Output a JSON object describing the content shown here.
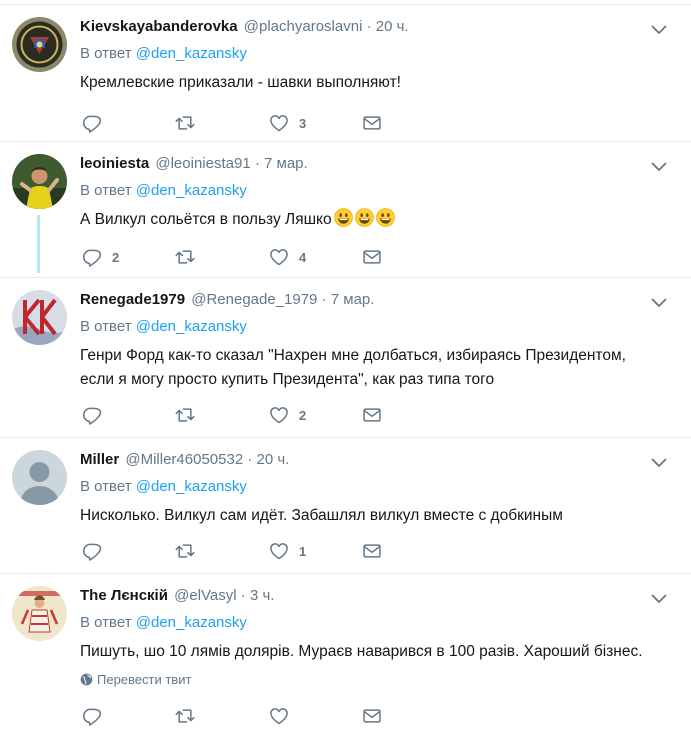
{
  "colors": {
    "accent": "#1da1f2",
    "muted": "#657786",
    "text": "#14171a",
    "border": "#e6ecf0"
  },
  "icons": {
    "reply": "reply-icon",
    "retweet": "retweet-icon",
    "like": "heart-icon",
    "message": "envelope-icon",
    "caret": "chevron-down-icon",
    "globe": "globe-icon"
  },
  "tweets": [
    {
      "fullname": "Kievskayabanderovka",
      "username": "@plachyaroslavni",
      "dot": "·",
      "time": "20 ч.",
      "reply_prefix": "В ответ",
      "reply_mention": "@den_kazansky",
      "text": "Кремлевские приказали - шавки выполняют!",
      "replies": "",
      "retweets": "",
      "likes": "3"
    },
    {
      "fullname": "leoiniesta",
      "username": "@leoiniesta91",
      "dot": "·",
      "time": "7 мар.",
      "reply_prefix": "В ответ",
      "reply_mention": "@den_kazansky",
      "text": "А Вилкул сольётся в пользу Ляшко",
      "replies": "2",
      "retweets": "",
      "likes": "4"
    },
    {
      "fullname": "Renegade1979",
      "username": "@Renegade_1979",
      "dot": "·",
      "time": "7 мар.",
      "reply_prefix": "В ответ",
      "reply_mention": "@den_kazansky",
      "text_line1": "Генри Форд как-то сказал \"Нахрен мне долбаться, избираясь Президентом,",
      "text_line2": "если я могу просто купить Президента\", как раз типа того",
      "replies": "",
      "retweets": "",
      "likes": "2"
    },
    {
      "fullname": "Miller",
      "username": "@Miller46050532",
      "dot": "·",
      "time": "20 ч.",
      "reply_prefix": "В ответ",
      "reply_mention": "@den_kazansky",
      "text": "Нисколько. Вилкул сам идёт. Забашлял вилкул вместе с добкиным",
      "replies": "",
      "retweets": "",
      "likes": "1"
    },
    {
      "fullname": "The Лєнскій",
      "username": "@elVasyl",
      "dot": "·",
      "time": "3 ч.",
      "reply_prefix": "В ответ",
      "reply_mention": "@den_kazansky",
      "text": "Пишуть, шо 10 лямів долярів. Мураєв наварився в 100 разів. Хароший бізнес.",
      "translate": "Перевести твит",
      "replies": "",
      "retweets": "",
      "likes": ""
    }
  ]
}
